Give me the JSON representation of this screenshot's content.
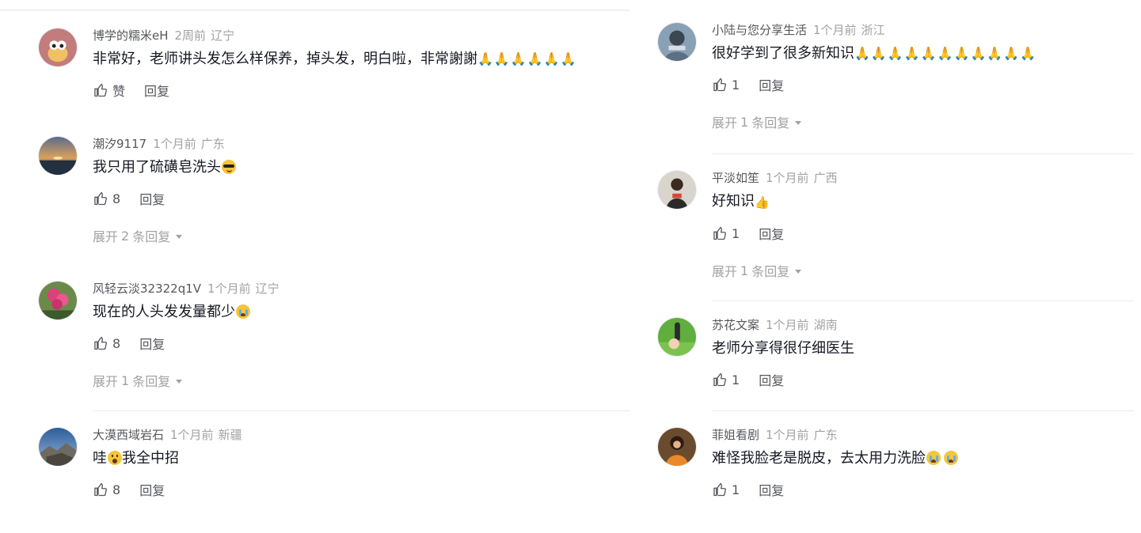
{
  "ui": {
    "like_placeholder": "赞",
    "reply_label": "回复",
    "expand_prefix": "展开 ",
    "expand_suffix": " 条回复"
  },
  "left_column": [
    {
      "name": "博学的糯米eH",
      "time": "2周前",
      "location": "辽宁",
      "text": "非常好，老师讲头发怎么样保养，掉头发，明白啦，非常謝謝",
      "emoji": "🙏🙏🙏🙏🙏🙏",
      "emoji_icon": "folded-hands-icon",
      "likes": "赞",
      "replies": null
    },
    {
      "name": "潮汐9117",
      "time": "1个月前",
      "location": "广东",
      "text": "我只用了硫磺皂洗头",
      "emoji_icon": "cool-face-icon",
      "likes": "8",
      "replies": "2"
    },
    {
      "name": "风轻云淡32322q1V",
      "time": "1个月前",
      "location": "辽宁",
      "text": "现在的人头发发量都少",
      "emoji_icon": "crying-face-icon",
      "likes": "8",
      "replies": "1"
    },
    {
      "name": "大漠西域岩石",
      "time": "1个月前",
      "location": "新疆",
      "text_before": "哇",
      "text_after": "我全中招",
      "emoji_icon": "astonished-face-icon",
      "likes": "8",
      "replies": null
    }
  ],
  "right_column": [
    {
      "name": "小陆与您分享生活",
      "time": "1个月前",
      "location": "浙江",
      "text": "很好学到了很多新知识",
      "emoji": "🙏🙏🙏🙏🙏🙏🙏🙏🙏🙏🙏",
      "emoji_icon": "folded-hands-icon",
      "likes": "1",
      "replies": "1"
    },
    {
      "name": "平淡如笙",
      "time": "1个月前",
      "location": "广西",
      "text": "好知识",
      "emoji": "👍",
      "emoji_icon": "thumbs-up-icon",
      "likes": "1",
      "replies": "1"
    },
    {
      "name": "苏花文案",
      "time": "1个月前",
      "location": "湖南",
      "text": "老师分享得很仔细医生",
      "likes": "1",
      "replies": null
    },
    {
      "name": "菲姐看剧",
      "time": "1个月前",
      "location": "广东",
      "text": "难怪我脸老是脱皮，去太用力洗脸",
      "emoji_icon": "crying-face-icon",
      "likes": "1",
      "replies": null
    }
  ],
  "colors": {
    "name": "#56575e",
    "meta": "#a1a2a7",
    "text": "#161823",
    "divider": "#ececee",
    "emoji": "#f5c53a"
  }
}
